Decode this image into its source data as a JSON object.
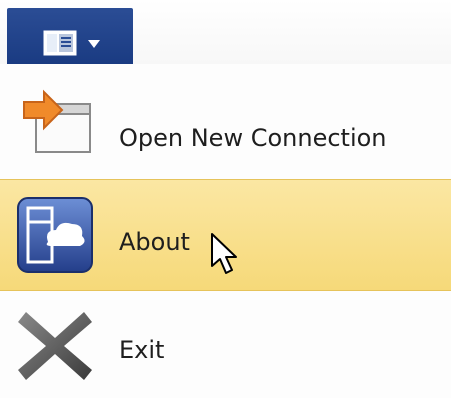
{
  "app_button": {
    "icon": "sidebar-panel-icon",
    "dropdown_icon": "caret-down-icon"
  },
  "menu": {
    "items": [
      {
        "label": "Open New Connection",
        "icon": "open-connection-icon",
        "highlighted": false
      },
      {
        "label": "About",
        "icon": "about-cloud-icon",
        "highlighted": true
      },
      {
        "label": "Exit",
        "icon": "exit-x-icon",
        "highlighted": false
      }
    ]
  },
  "colors": {
    "app_button": "#1a3b82",
    "highlight": "#f6d979",
    "highlight_border": "#e6c35a",
    "arrow_orange": "#f08a2a",
    "exit_gray": "#555555"
  },
  "pointer": {
    "icon": "mouse-cursor-icon"
  }
}
